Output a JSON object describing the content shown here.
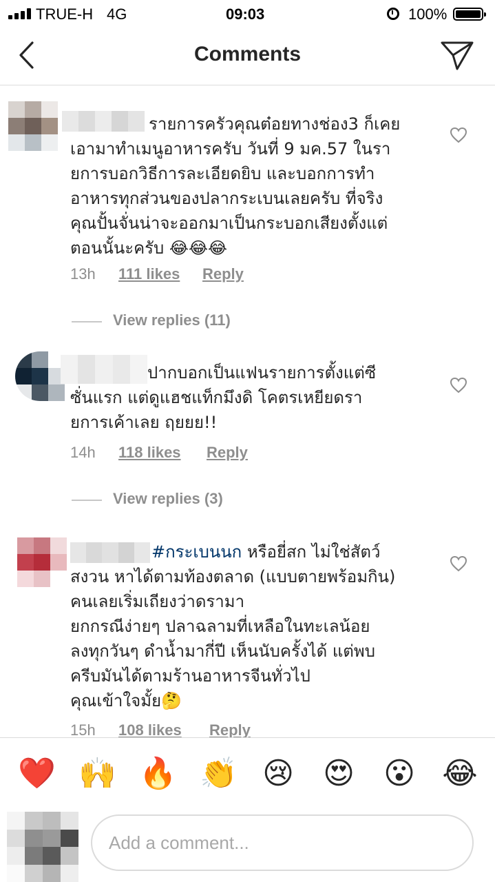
{
  "status_bar": {
    "carrier": "TRUE-H",
    "network": "4G",
    "time": "09:03",
    "battery": "100%"
  },
  "header": {
    "title": "Comments",
    "back_icon": "chevron-left-icon",
    "send_icon": "paper-plane-icon"
  },
  "comments": [
    {
      "lines": [
        "รายการครัวคุณต๋อยทางช่อง3 ก็เคย",
        "เอามาทำเมนูอาหารครับ วันที่ 9 มค.57 ในรา",
        "ยการบอกวิธีการละเอียดยิบ และบอกการทำ",
        "อาหารทุกส่วนของปลากระเบนเลยครับ ที่จริง",
        "คุณปั้นจั่นน่าจะออกมาเป็นกระบอกเสียงตั้งแต่",
        "ตอนนั้นะครับ 😂😂😂"
      ],
      "time": "13h",
      "likes": "111 likes",
      "reply": "Reply",
      "view_replies": "View replies (11)"
    },
    {
      "lines": [
        "ปากบอกเป็นแฟนรายการตั้งแต่ซี",
        "ซั่นแรก แต่ดูแฮชแท็กมึงดิ โคตรเหยียดรา",
        "ยการเค้าเลย ฤยยย!!"
      ],
      "time": "14h",
      "likes": "118 likes",
      "reply": "Reply",
      "view_replies": "View replies (3)"
    },
    {
      "hashtag": "#กระเบนนก",
      "first_line_rest": " หรือยี่สก ไม่ใช่สัตว์",
      "lines": [
        "สงวน หาได้ตามท้องตลาด (แบบตายพร้อมกิน)",
        "คนเลยเริ่มเถียงว่าดรามา",
        "ยกกรณีง่ายๆ ปลาฉลามที่เหลือในทะเลน้อย",
        "ลงทุกวันๆ ดำน้ำมากี่ปี เห็นนับครั้งได้ แต่พบ",
        "ครีบมันได้ตามร้านอาหารจีนทั่วไป",
        "คุณเข้าใจมั้ย🤔"
      ],
      "time": "15h",
      "likes": "108 likes",
      "reply": "Reply"
    }
  ],
  "emoji_bar": [
    "❤️",
    "🙌",
    "🔥",
    "👏",
    "😢",
    "😍",
    "😮",
    "😂"
  ],
  "composer": {
    "placeholder": "Add a comment..."
  }
}
